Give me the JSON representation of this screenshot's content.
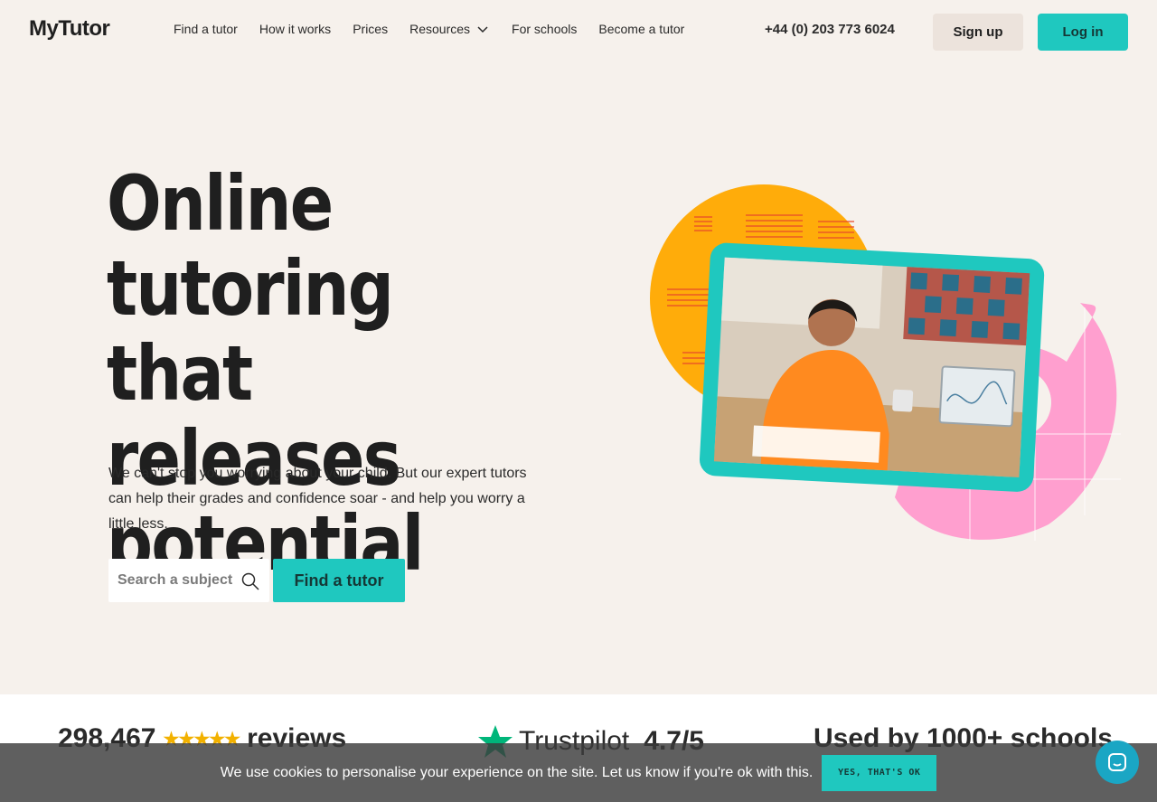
{
  "nav": {
    "logo": "MyTutor",
    "links": [
      "Find a tutor",
      "How it works",
      "Prices",
      "Resources",
      "For schools",
      "Become a tutor"
    ],
    "phone": "+44 (0) 203 773 6024",
    "signup": "Sign up",
    "login": "Log in"
  },
  "hero": {
    "title_line1": "Online tutoring",
    "title_line2": "that releases",
    "title_line3": "potential",
    "text": "We can't stop you worrying about your child. But our expert tutors can help their grades and confidence soar - and help you worry a little less.",
    "search_placeholder": "Search a subject",
    "find_button": "Find a tutor"
  },
  "stats": {
    "reviews_count": "298,467",
    "reviews_stars": "★★★★★",
    "reviews_label": "reviews",
    "trustpilot_label": "Trustpilot",
    "trustpilot_score": "4.7/5",
    "schools": "Used by 1000+ schools"
  },
  "cookie": {
    "text": "We use cookies to personalise your experience on the site. Let us know if you're ok with this.",
    "button": "YES, THAT'S OK"
  },
  "colors": {
    "accent": "#1fc8bf",
    "background": "#f6f1ec",
    "orange": "#ffac0a",
    "pink": "#ff9fcf"
  }
}
